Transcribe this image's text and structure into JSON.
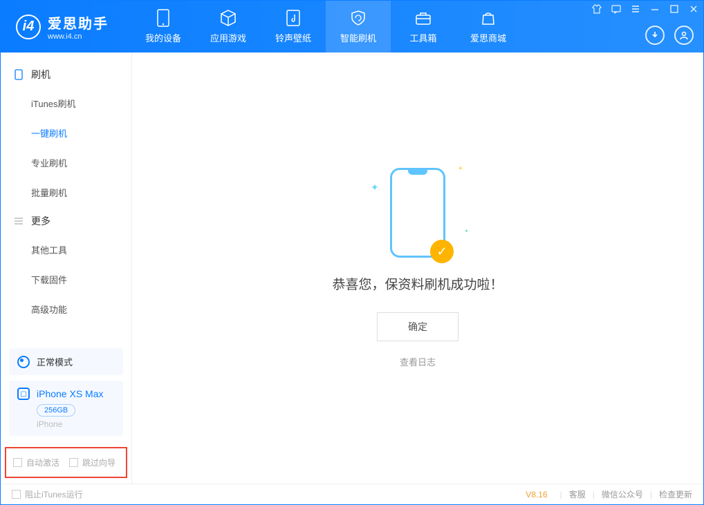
{
  "brand": {
    "title": "爱思助手",
    "subtitle": "www.i4.cn"
  },
  "tabs": [
    {
      "label": "我的设备"
    },
    {
      "label": "应用游戏"
    },
    {
      "label": "铃声壁纸"
    },
    {
      "label": "智能刷机"
    },
    {
      "label": "工具箱"
    },
    {
      "label": "爱思商城"
    }
  ],
  "sidebar": {
    "group1": {
      "title": "刷机",
      "items": [
        "iTunes刷机",
        "一键刷机",
        "专业刷机",
        "批量刷机"
      ]
    },
    "group2": {
      "title": "更多",
      "items": [
        "其他工具",
        "下载固件",
        "高级功能"
      ]
    },
    "mode": "正常模式",
    "device": {
      "name": "iPhone XS Max",
      "capacity": "256GB",
      "type": "iPhone"
    },
    "checks": {
      "auto_activate": "自动激活",
      "skip_guide": "跳过向导"
    }
  },
  "main": {
    "success_text": "恭喜您，保资料刷机成功啦！",
    "ok_label": "确定",
    "log_link": "查看日志"
  },
  "footer": {
    "block_itunes": "阻止iTunes运行",
    "version": "V8.16",
    "links": [
      "客服",
      "微信公众号",
      "检查更新"
    ]
  }
}
